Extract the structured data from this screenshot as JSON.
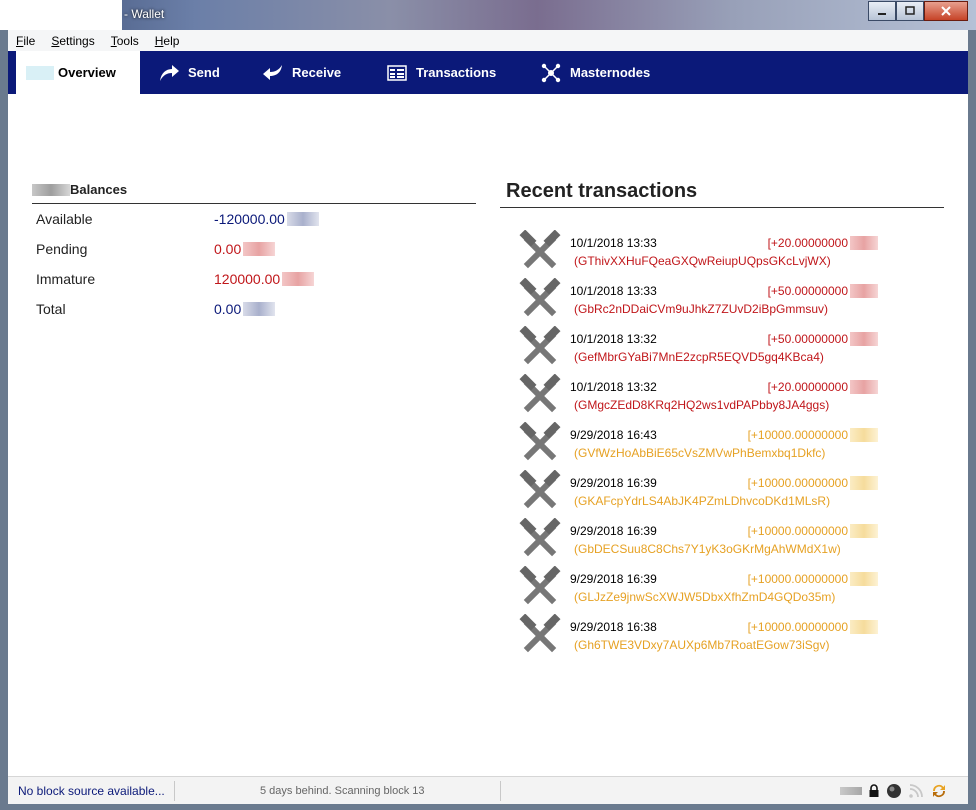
{
  "window": {
    "title": "- Wallet"
  },
  "menu": [
    {
      "label": "File",
      "mnemonic": "F",
      "rest": "ile"
    },
    {
      "label": "Settings",
      "mnemonic": "S",
      "rest": "ettings"
    },
    {
      "label": "Tools",
      "mnemonic": "T",
      "rest": "ools"
    },
    {
      "label": "Help",
      "mnemonic": "H",
      "rest": "elp"
    }
  ],
  "nav": {
    "overview": "Overview",
    "send": "Send",
    "receive": "Receive",
    "transactions": "Transactions",
    "masternodes": "Masternodes"
  },
  "balances": {
    "title": "Balances",
    "available_label": "Available",
    "available_value": "-120000.00",
    "pending_label": "Pending",
    "pending_value": "0.00",
    "immature_label": "Immature",
    "immature_value": "120000.00",
    "total_label": "Total",
    "total_value": "0.00"
  },
  "recent": {
    "title": "Recent transactions",
    "items": [
      {
        "date": "10/1/2018 13:33",
        "amount": "[+20.00000000",
        "address": "(GThivXXHuFQeaGXQwReiupUQpsGKcLvjWX)",
        "color": "#c0161a"
      },
      {
        "date": "10/1/2018 13:33",
        "amount": "[+50.00000000",
        "address": "(GbRc2nDDaiCVm9uJhkZ7ZUvD2iBpGmmsuv)",
        "color": "#c0161a"
      },
      {
        "date": "10/1/2018 13:32",
        "amount": "[+50.00000000",
        "address": "(GefMbrGYaBi7MnE2zcpR5EQVD5gq4KBca4)",
        "color": "#c0161a"
      },
      {
        "date": "10/1/2018 13:32",
        "amount": "[+20.00000000",
        "address": "(GMgcZEdD8KRq2HQ2ws1vdPAPbby8JA4ggs)",
        "color": "#c0161a"
      },
      {
        "date": "9/29/2018 16:43",
        "amount": "[+10000.00000000",
        "address": "(GVfWzHoAbBiE65cVsZMVwPhBemxbq1Dkfc)",
        "color": "#e6a123"
      },
      {
        "date": "9/29/2018 16:39",
        "amount": "[+10000.00000000",
        "address": "(GKAFcpYdrLS4AbJK4PZmLDhvcoDKd1MLsR)",
        "color": "#e6a123"
      },
      {
        "date": "9/29/2018 16:39",
        "amount": "[+10000.00000000",
        "address": "(GbDECSuu8C8Chs7Y1yK3oGKrMgAhWMdX1w)",
        "color": "#e6a123"
      },
      {
        "date": "9/29/2018 16:39",
        "amount": "[+10000.00000000",
        "address": "(GLJzZe9jnwScXWJW5DbxXfhZmD4GQDo35m)",
        "color": "#e6a123"
      },
      {
        "date": "9/29/2018 16:38",
        "amount": "[+10000.00000000",
        "address": "(Gh6TWE3VDxy7AUXp6Mb7RoatEGow73iSgv)",
        "color": "#e6a123"
      }
    ]
  },
  "status": {
    "left": "No block source available...",
    "middle": "5 days behind. Scanning block 13"
  },
  "colors": {
    "nav_bg": "#0b1979",
    "negative": "#c0161a",
    "immature_tx": "#e6a123"
  }
}
